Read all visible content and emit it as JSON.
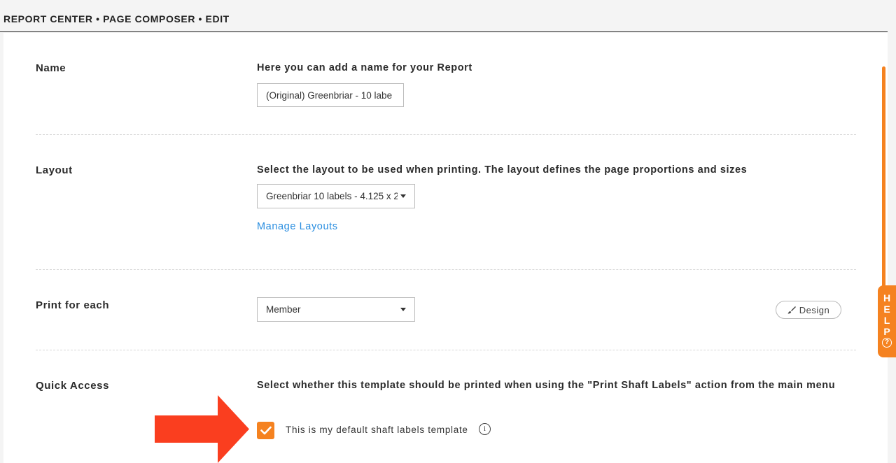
{
  "breadcrumb": "REPORT CENTER • PAGE COMPOSER • EDIT",
  "help_tab": {
    "letters": [
      "H",
      "E",
      "L",
      "P"
    ],
    "icon": "question-circle-icon"
  },
  "name_section": {
    "label": "Name",
    "description": "Here you can add a name for your Report",
    "input_value": "(Original) Greenbriar - 10 labe"
  },
  "layout_section": {
    "label": "Layout",
    "description": "Select the layout to be used when printing. The layout defines the page proportions and sizes",
    "selected_layout": "Greenbriar 10 labels - 4.125 x 2",
    "manage_link": "Manage Layouts"
  },
  "print_section": {
    "label": "Print for each",
    "selected_value": "Member",
    "design_button": "Design",
    "design_icon": "brush-icon"
  },
  "quick_access_section": {
    "label": "Quick Access",
    "description": "Select whether this template should be printed when using the \"Print Shaft Labels\" action from the main menu",
    "checkbox_checked": true,
    "checkbox_label": "This is my default shaft labels template",
    "info_icon": "info-icon"
  },
  "colors": {
    "accent": "#f58220",
    "link": "#2a8ee0",
    "annotation_arrow": "#fa3e1f"
  }
}
